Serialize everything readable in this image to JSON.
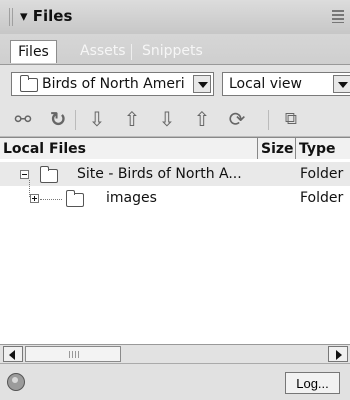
{
  "panel": {
    "title": "Files",
    "collapse_icon": "triangle-down-icon",
    "menu_icon": "panel-menu-icon"
  },
  "tabs": [
    {
      "label": "Files",
      "active": true
    },
    {
      "label": "Assets",
      "active": false
    },
    {
      "label": "Snippets",
      "active": false
    }
  ],
  "toolbar": {
    "site_select": {
      "value": "Birds of North Ameri",
      "icon": "folder-icon"
    },
    "view_select": {
      "value": "Local view"
    },
    "buttons": [
      {
        "icon": "connect-icon"
      },
      {
        "icon": "refresh-icon"
      },
      {
        "icon": "get-icon"
      },
      {
        "icon": "put-icon"
      },
      {
        "icon": "check-out-icon"
      },
      {
        "icon": "check-in-icon"
      },
      {
        "icon": "synchronize-icon"
      },
      {
        "icon": "expand-icon"
      }
    ]
  },
  "columns": {
    "name": "Local Files",
    "size": "Size",
    "type": "Type"
  },
  "rows": [
    {
      "name": "Site - Birds of North A...",
      "type": "Folder",
      "expanded": true
    },
    {
      "name": "images",
      "type": "Folder",
      "expanded": false
    }
  ],
  "status": {
    "log_button": "Log..."
  },
  "colors": {
    "header_bg": "#c7c7c7",
    "toolbar_bg": "#e4e4e4",
    "selected_row_bg": "#e9e9e9"
  }
}
